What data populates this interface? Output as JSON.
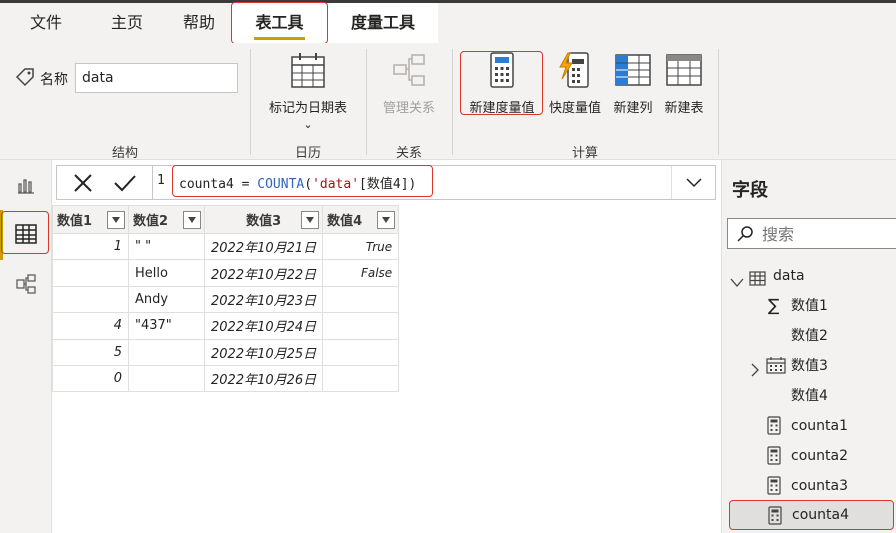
{
  "menu": {
    "tabs": [
      "文件",
      "主页",
      "帮助",
      "表工具",
      "度量工具"
    ],
    "active": "表工具"
  },
  "ribbon": {
    "structure": {
      "name_label": "名称",
      "name_value": "data",
      "group_label": "结构"
    },
    "calendar": {
      "mark_date_table": "标记为日期表",
      "group_label": "日历"
    },
    "relations": {
      "manage": "管理关系",
      "group_label": "关系"
    },
    "calc": {
      "new_measure": "新建度量值",
      "quick_measure": "快度量值",
      "new_column": "新建列",
      "new_table": "新建表",
      "group_label": "计算"
    }
  },
  "formula": {
    "line_number": "1",
    "name": "counta4",
    "eq": " = ",
    "func": "COUNTA",
    "open": "(",
    "table": "'data'",
    "column": "[数值4]",
    "close": ")"
  },
  "table": {
    "headers": [
      "数值1",
      "数值2",
      "数值3",
      "数值4"
    ],
    "rows": [
      [
        "1",
        "\" \"",
        "2022年10月21日",
        "True"
      ],
      [
        "",
        "Hello",
        "2022年10月22日",
        "False"
      ],
      [
        "",
        "Andy",
        "2022年10月23日",
        ""
      ],
      [
        "4",
        "\"437\"",
        "2022年10月24日",
        ""
      ],
      [
        "5",
        "",
        "2022年10月25日",
        ""
      ],
      [
        "0",
        "",
        "2022年10月26日",
        ""
      ]
    ]
  },
  "fields_pane": {
    "title": "字段",
    "search_placeholder": "搜索",
    "table_name": "data",
    "fields": [
      "数值1",
      "数值2",
      "数值3",
      "数值4"
    ],
    "measures": [
      "counta1",
      "counta2",
      "counta3",
      "counta4"
    ],
    "selected": "counta4"
  },
  "colors": {
    "accent": "#c8a100",
    "highlight": "#d9362c",
    "ribbon_bg": "#f3f2f1",
    "function": "#3165bb",
    "string": "#a31515"
  }
}
